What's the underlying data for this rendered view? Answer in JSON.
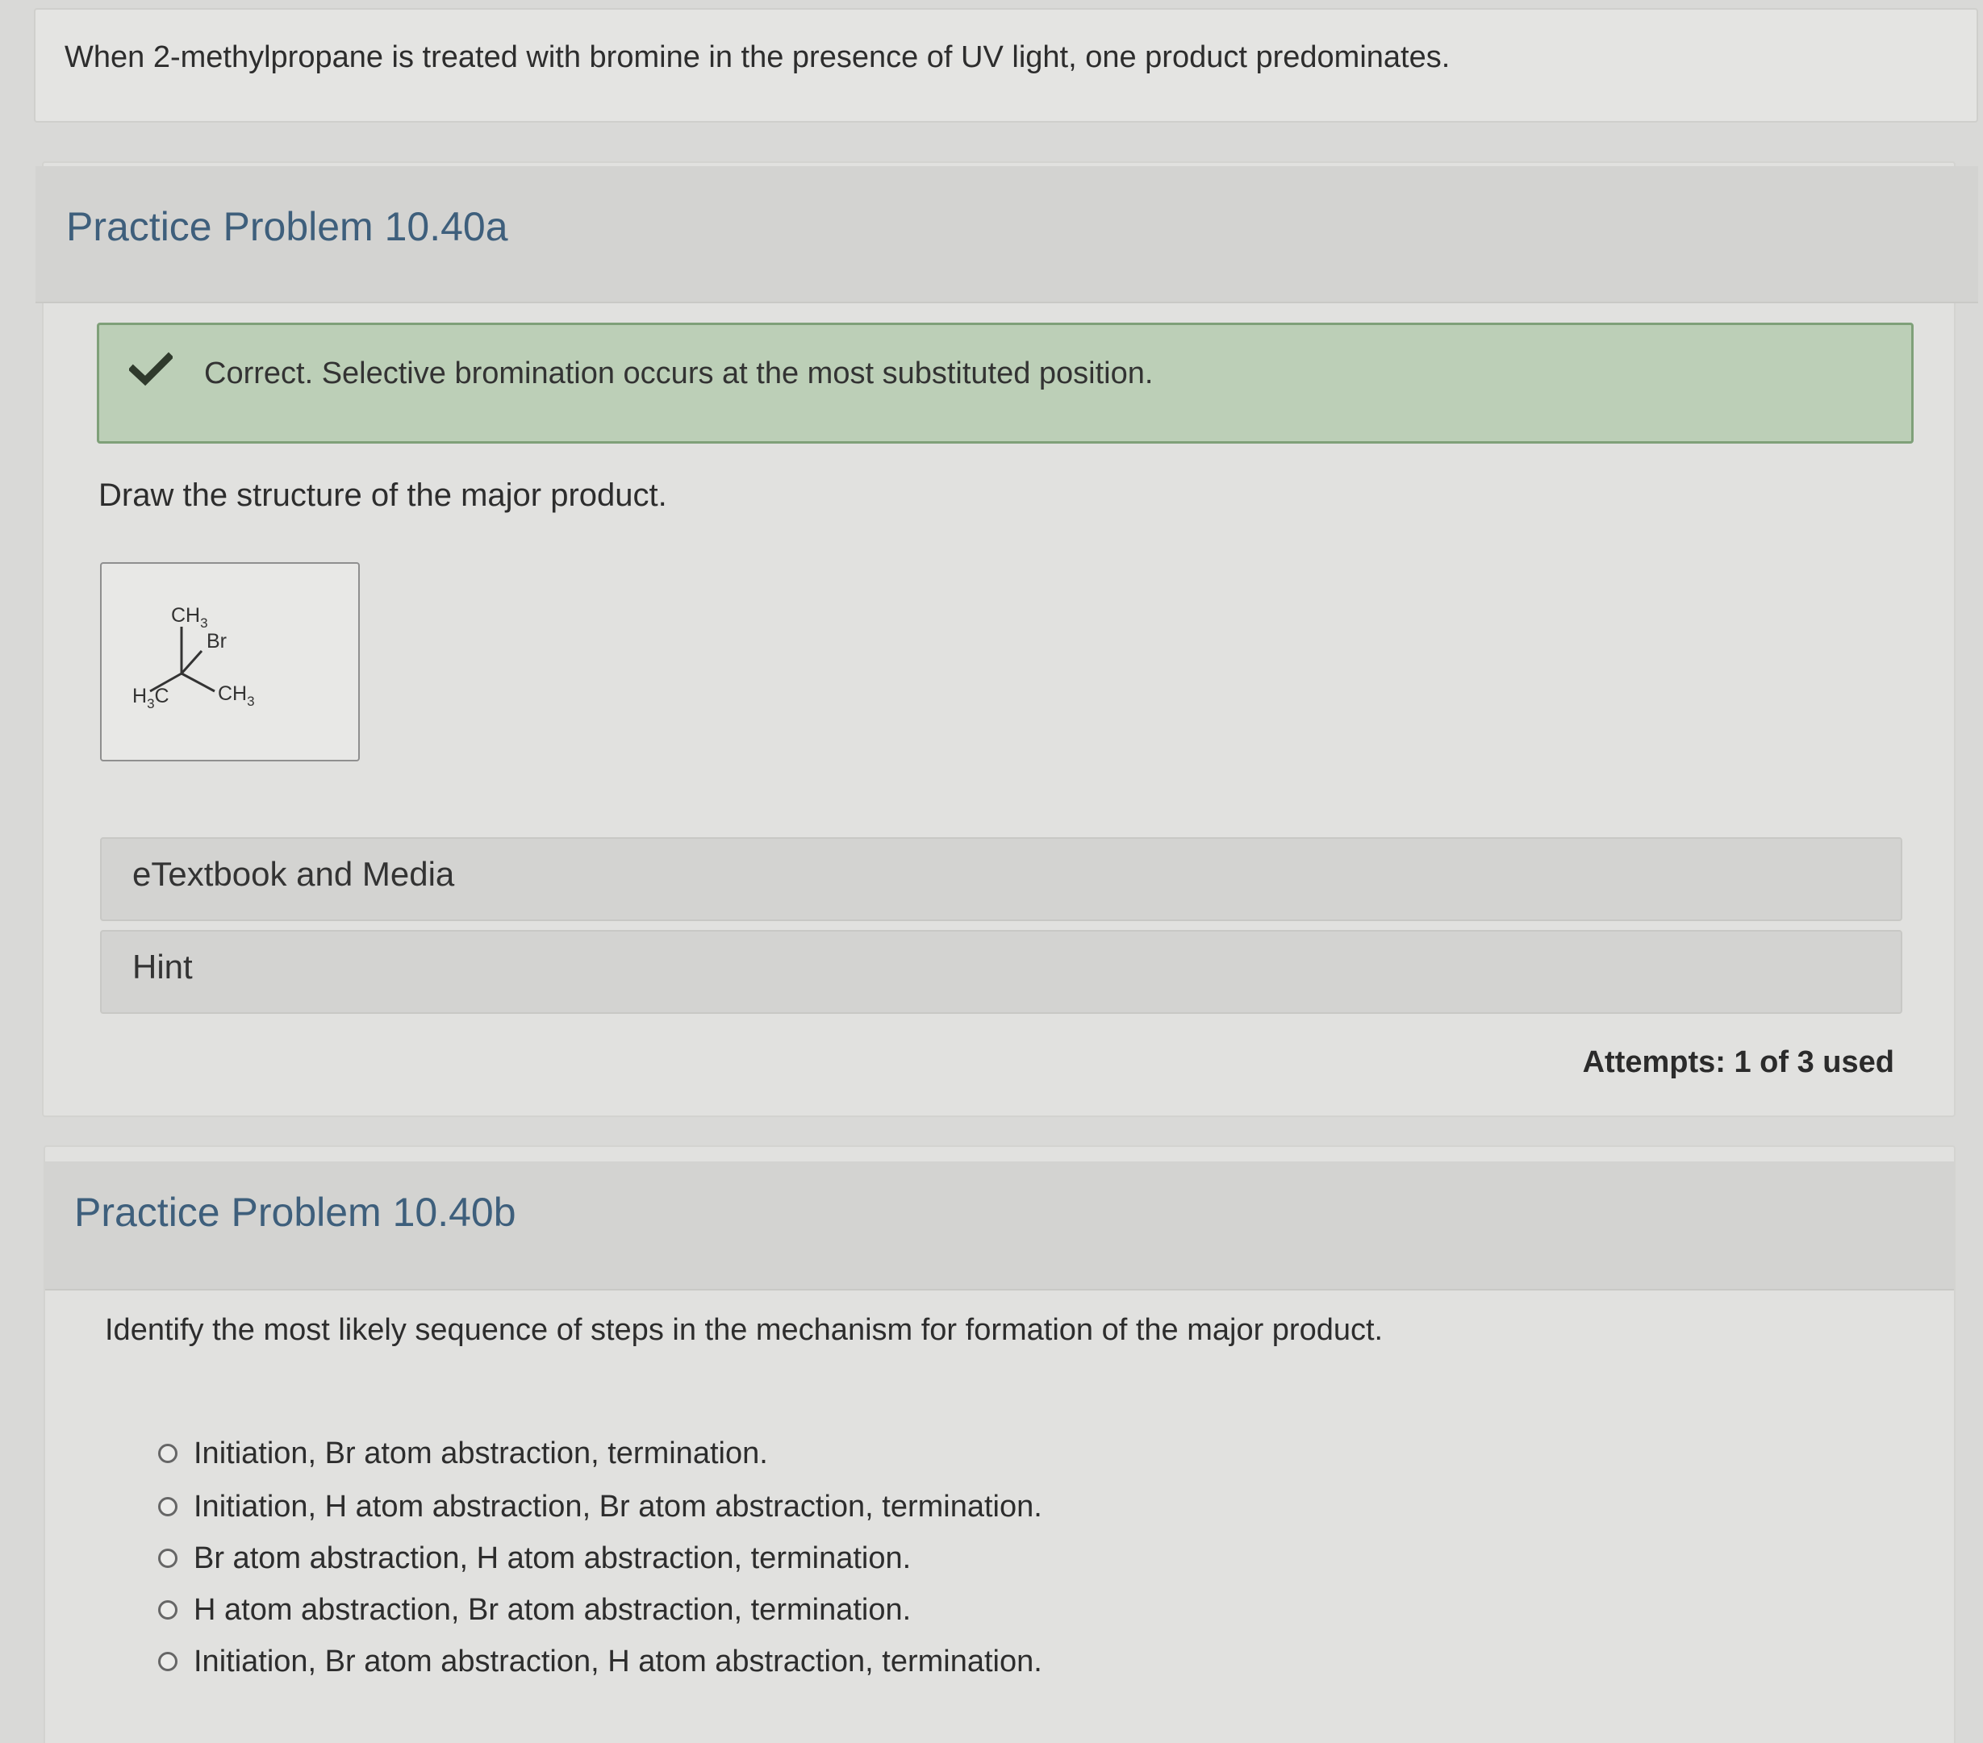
{
  "intro": {
    "text": "When 2-methylpropane is treated with bromine in the presence of UV light, one product predominates."
  },
  "problem_a": {
    "title": "Practice Problem 10.40a",
    "feedback": "Correct. Selective bromination occurs at the most substituted position.",
    "prompt": "Draw the structure of the major product.",
    "molecule": {
      "top_group": "CH3",
      "substituent": "Br",
      "left_group": "H3C",
      "right_group": "CH3"
    },
    "accordions": {
      "media": "eTextbook and Media",
      "hint": "Hint"
    },
    "attempts": "Attempts: 1 of 3 used"
  },
  "problem_b": {
    "title": "Practice Problem 10.40b",
    "prompt": "Identify the most likely sequence of steps in the mechanism for formation of the major product.",
    "options": [
      "Initiation, Br atom abstraction, termination.",
      "Initiation, H atom abstraction, Br atom abstraction, termination.",
      "Br atom abstraction, H atom abstraction, termination.",
      "H atom abstraction, Br atom abstraction, termination.",
      "Initiation, Br atom abstraction, H atom abstraction, termination."
    ]
  },
  "colors": {
    "title": "#3e5f7c",
    "feedback_bg": "#bccfb7",
    "feedback_border": "#7fa079",
    "check": "#2f3a2c"
  },
  "icons": {
    "feedback": "check-icon",
    "option": "radio-icon"
  }
}
